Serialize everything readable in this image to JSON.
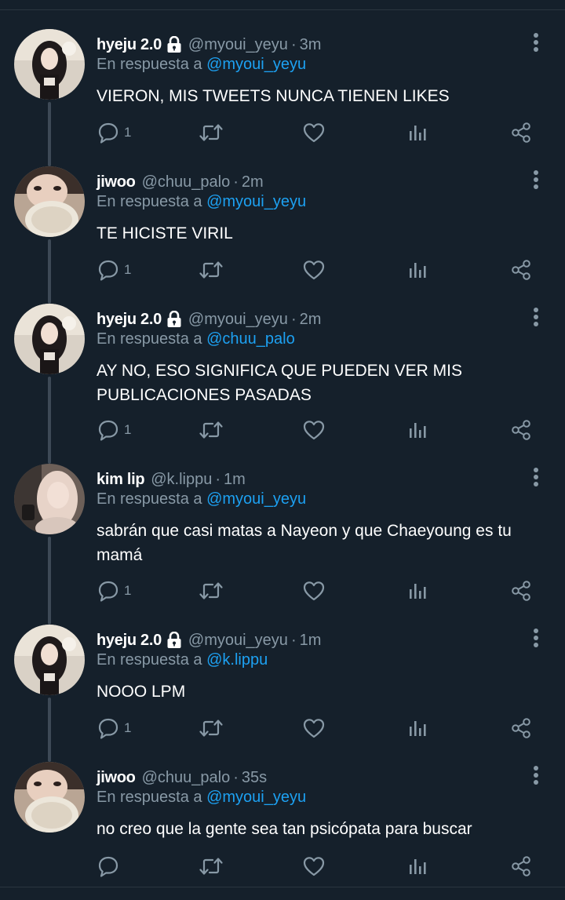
{
  "colors": {
    "background": "#15202b",
    "name_text": "#ffffff",
    "secondary_text": "#8899a6",
    "link": "#1da1f2",
    "thread_line": "#3d4956"
  },
  "tweets": [
    {
      "display_name": "hyeju 2.0",
      "locked": true,
      "handle": "@myoui_yeyu",
      "separator": "·",
      "time": "3m",
      "reply_prefix": "En respuesta a",
      "reply_to": "@myoui_yeyu",
      "text": "VIERON, MIS TWEETS NUNCA TIENEN LIKES",
      "reply_count": "1",
      "avatar_icon": "avatar-hyeju"
    },
    {
      "display_name": "jiwoo",
      "locked": false,
      "handle": "@chuu_palo",
      "separator": "·",
      "time": "2m",
      "reply_prefix": "En respuesta a",
      "reply_to": "@myoui_yeyu",
      "text": "TE HICISTE VIRIL",
      "reply_count": "1",
      "avatar_icon": "avatar-jiwoo"
    },
    {
      "display_name": "hyeju 2.0",
      "locked": true,
      "handle": "@myoui_yeyu",
      "separator": "·",
      "time": "2m",
      "reply_prefix": "En respuesta a",
      "reply_to": "@chuu_palo",
      "text": "AY NO, ESO SIGNIFICA QUE PUEDEN VER MIS PUBLICACIONES PASADAS",
      "reply_count": "1",
      "avatar_icon": "avatar-hyeju"
    },
    {
      "display_name": "kim lip",
      "locked": false,
      "handle": "@k.lippu",
      "separator": "·",
      "time": "1m",
      "reply_prefix": "En respuesta a",
      "reply_to": "@myoui_yeyu",
      "text": "sabrán que casi matas a Nayeon y que Chaeyoung es tu mamá",
      "reply_count": "1",
      "avatar_icon": "avatar-kimlip"
    },
    {
      "display_name": "hyeju 2.0",
      "locked": true,
      "handle": "@myoui_yeyu",
      "separator": "·",
      "time": "1m",
      "reply_prefix": "En respuesta a",
      "reply_to": "@k.lippu",
      "text": "NOOO LPM",
      "reply_count": "1",
      "avatar_icon": "avatar-hyeju"
    },
    {
      "display_name": "jiwoo",
      "locked": false,
      "handle": "@chuu_palo",
      "separator": "·",
      "time": "35s",
      "reply_prefix": "En respuesta a",
      "reply_to": "@myoui_yeyu",
      "text": "no creo que la gente sea tan psicópata para buscar",
      "reply_count": "",
      "avatar_icon": "avatar-jiwoo"
    }
  ]
}
